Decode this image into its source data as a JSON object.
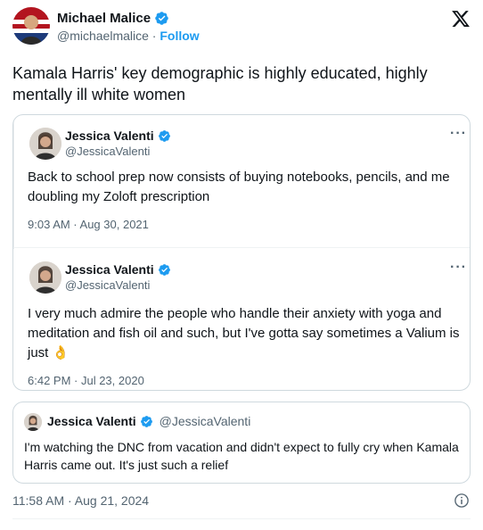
{
  "author": {
    "name": "Michael Malice",
    "handle": "@michaelmalice",
    "separator": " · ",
    "follow_label": "Follow"
  },
  "tweet": {
    "text": "Kamala Harris' key demographic is highly educated, highly mentally ill white women",
    "timestamp": "11:58 AM · Aug 21, 2024"
  },
  "embedded_thread": [
    {
      "name": "Jessica Valenti",
      "handle": "@JessicaValenti",
      "more": "···",
      "text": "Back to school prep now consists of buying notebooks, pencils, and me doubling my Zoloft prescription",
      "timestamp": "9:03 AM · Aug 30, 2021"
    },
    {
      "name": "Jessica Valenti",
      "handle": "@JessicaValenti",
      "more": "···",
      "text": "I very much admire the people who handle their anxiety with yoga and meditation and fish oil and such, but I've gotta say sometimes a Valium is just 👌",
      "timestamp": "6:42 PM · Jul 23, 2020"
    }
  ],
  "quoted": {
    "name": "Jessica Valenti",
    "handle": "@JessicaValenti",
    "text": "I'm watching the DNC from vacation and didn't expect to fully cry when Kamala Harris came out. It's just such a relief"
  },
  "colors": {
    "verified": "#1d9bf0",
    "secondary_text": "#536471",
    "border": "#cfd9de"
  },
  "icons": [
    "verified-badge-icon",
    "x-logo-icon",
    "more-icon",
    "info-icon"
  ]
}
